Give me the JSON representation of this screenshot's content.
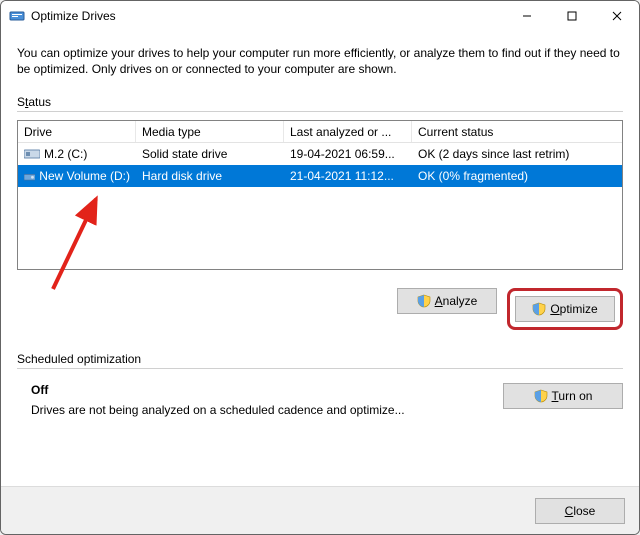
{
  "window": {
    "title": "Optimize Drives"
  },
  "description": "You can optimize your drives to help your computer run more efficiently, or analyze them to find out if they need to be optimized. Only drives on or connected to your computer are shown.",
  "status_label_pre": "S",
  "status_label_ul": "t",
  "status_label_post": "atus",
  "columns": {
    "drive": "Drive",
    "media": "Media type",
    "last": "Last analyzed or ...",
    "status": "Current status"
  },
  "rows": [
    {
      "drive": "M.2 (C:)",
      "media": "Solid state drive",
      "last": "19-04-2021 06:59...",
      "status": "OK (2 days since last retrim)",
      "selected": false
    },
    {
      "drive": "New Volume (D:)",
      "media": "Hard disk drive",
      "last": "21-04-2021 11:12...",
      "status": "OK (0% fragmented)",
      "selected": true
    }
  ],
  "buttons": {
    "analyze_ul": "A",
    "analyze_post": "nalyze",
    "optimize_ul": "O",
    "optimize_post": "ptimize",
    "turnon_ul": "T",
    "turnon_post": "urn on",
    "close_ul": "C",
    "close_post": "lose"
  },
  "sched": {
    "label": "Scheduled optimization",
    "off": "Off",
    "desc": "Drives are not being analyzed on a scheduled cadence and optimize..."
  }
}
